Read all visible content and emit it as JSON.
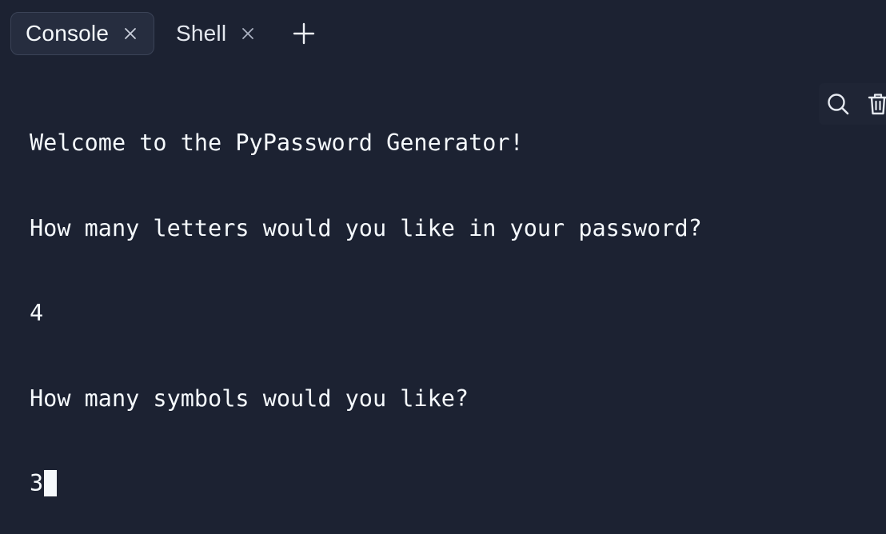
{
  "tabs": [
    {
      "label": "Console",
      "active": true,
      "close_icon": "close-icon"
    },
    {
      "label": "Shell",
      "active": false,
      "close_icon": "close-icon"
    }
  ],
  "add_tab_icon": "plus-icon",
  "console": {
    "lines": [
      "Welcome to the PyPassword Generator!",
      "How many letters would you like in your password?",
      "4",
      "How many symbols would you like?"
    ],
    "current_input": "3"
  },
  "toolbar": {
    "icons": [
      "search-icon",
      "trash-icon"
    ]
  },
  "colors": {
    "background": "#1c2232",
    "active_tab": "#262d3f",
    "text": "#f5f9fc"
  }
}
